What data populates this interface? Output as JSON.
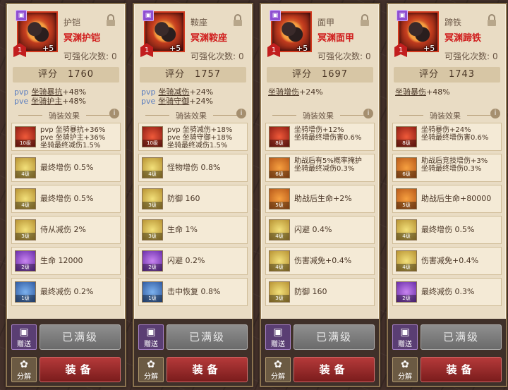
{
  "cards": [
    {
      "slot": "护铠",
      "name": "冥渊护铠",
      "level": "1",
      "plus": "+5",
      "enhance_label": "可强化次数:",
      "enhance_count": "0",
      "score_label": "评分",
      "score": "1760",
      "attrs": [
        {
          "k": "pvp",
          "v": "坐骑暴抗",
          "n": "+48%"
        },
        {
          "k": "pve",
          "v": "坐骑护主",
          "n": "+48%"
        }
      ],
      "mount_label": "骑装效果",
      "effects": [
        {
          "color": "red",
          "lv": "10级",
          "lines": [
            "pvp 坐骑暴抗+36%",
            "pve 坐骑护主+36%",
            "坐骑最终减伤1.5%"
          ]
        },
        {
          "color": "gold",
          "lv": "4级",
          "lines": [
            "最终增伤 0.5%"
          ]
        },
        {
          "color": "gold",
          "lv": "4级",
          "lines": [
            "最终增伤 0.5%"
          ]
        },
        {
          "color": "gold",
          "lv": "3级",
          "lines": [
            "侍从减伤 2%"
          ]
        },
        {
          "color": "purple",
          "lv": "2级",
          "lines": [
            "生命 12000"
          ]
        },
        {
          "color": "blue",
          "lv": "1级",
          "lines": [
            "最终减伤 0.2%"
          ]
        }
      ],
      "gift_label": "赠送",
      "max_label": "已满级",
      "split_label": "分解",
      "equip_label": "装备"
    },
    {
      "slot": "鞍座",
      "name": "冥渊鞍座",
      "level": "1",
      "plus": "+5",
      "enhance_label": "可强化次数:",
      "enhance_count": "0",
      "score_label": "评分",
      "score": "1757",
      "attrs": [
        {
          "k": "pvp",
          "v": "坐骑减伤",
          "n": "+24%"
        },
        {
          "k": "pve",
          "v": "坐骑守御",
          "n": "+24%"
        }
      ],
      "mount_label": "骑装效果",
      "effects": [
        {
          "color": "red",
          "lv": "10级",
          "lines": [
            "pvp 坐骑减伤+18%",
            "pve 坐骑守御+18%",
            "坐骑最终减伤1.5%"
          ]
        },
        {
          "color": "gold",
          "lv": "4级",
          "lines": [
            "怪物增伤 0.8%"
          ]
        },
        {
          "color": "gold",
          "lv": "3级",
          "lines": [
            "防御 160"
          ]
        },
        {
          "color": "gold",
          "lv": "3级",
          "lines": [
            "生命 1%"
          ]
        },
        {
          "color": "purple",
          "lv": "2级",
          "lines": [
            "闪避 0.2%"
          ]
        },
        {
          "color": "blue",
          "lv": "1级",
          "lines": [
            "击中恢复 0.8%"
          ]
        }
      ],
      "gift_label": "赠送",
      "max_label": "已满级",
      "split_label": "分解",
      "equip_label": "装备"
    },
    {
      "slot": "面甲",
      "name": "冥渊面甲",
      "level": "1",
      "plus": "+5",
      "enhance_label": "可强化次数:",
      "enhance_count": "0",
      "score_label": "评分",
      "score": "1697",
      "attrs": [
        {
          "k": "",
          "v": "坐骑增伤",
          "n": "+24%"
        }
      ],
      "mount_label": "骑装效果",
      "effects": [
        {
          "color": "red",
          "lv": "8级",
          "lines": [
            "坐骑增伤+12%",
            "坐骑最终增伤害0.6%"
          ]
        },
        {
          "color": "orange",
          "lv": "6级",
          "lines": [
            "助战后有5%概率掩护",
            "坐骑最终减伤0.3%"
          ]
        },
        {
          "color": "orange",
          "lv": "5级",
          "lines": [
            "助战后生命+2%"
          ]
        },
        {
          "color": "gold",
          "lv": "4级",
          "lines": [
            "闪避 0.4%"
          ]
        },
        {
          "color": "gold",
          "lv": "4级",
          "lines": [
            "伤害减免+0.4%"
          ]
        },
        {
          "color": "gold",
          "lv": "3级",
          "lines": [
            "防御 160"
          ]
        }
      ],
      "gift_label": "赠送",
      "max_label": "已满级",
      "split_label": "分解",
      "equip_label": "装备"
    },
    {
      "slot": "蹄铁",
      "name": "冥渊蹄铁",
      "level": "1",
      "plus": "+5",
      "enhance_label": "可强化次数:",
      "enhance_count": "0",
      "score_label": "评分",
      "score": "1743",
      "attrs": [
        {
          "k": "",
          "v": "坐骑暴伤",
          "n": "+48%"
        }
      ],
      "mount_label": "骑装效果",
      "effects": [
        {
          "color": "red",
          "lv": "8级",
          "lines": [
            "坐骑暴伤+24%",
            "坐骑最终增伤害0.6%"
          ]
        },
        {
          "color": "orange",
          "lv": "6级",
          "lines": [
            "助战后竞技增伤+3%",
            "坐骑最终增伤0.3%"
          ]
        },
        {
          "color": "orange",
          "lv": "5级",
          "lines": [
            "助战后生命+80000"
          ]
        },
        {
          "color": "gold",
          "lv": "4级",
          "lines": [
            "最终增伤 0.5%"
          ]
        },
        {
          "color": "gold",
          "lv": "4级",
          "lines": [
            "伤害减免+0.4%"
          ]
        },
        {
          "color": "purple",
          "lv": "2级",
          "lines": [
            "最终减伤 0.3%"
          ]
        }
      ],
      "gift_label": "赠送",
      "max_label": "已满级",
      "split_label": "分解",
      "equip_label": "装备"
    }
  ]
}
